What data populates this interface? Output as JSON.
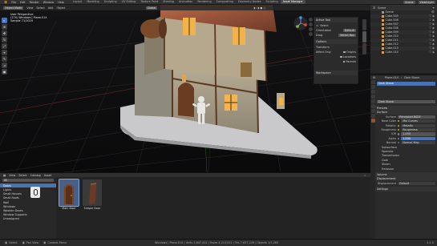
{
  "topbar": {
    "menus": [
      "File",
      "Edit",
      "Render",
      "Window",
      "Help"
    ],
    "tabs": [
      "Layout",
      "Modeling",
      "Sculpting",
      "UV Editing",
      "Texture Paint",
      "Shading",
      "Animation",
      "Rendering",
      "Compositing",
      "Geometry Nodes",
      "Scripting",
      "Asset Manager"
    ],
    "active_tab": "Asset Manager",
    "scene_label": "Scene",
    "view_layer_label": "ViewLayer"
  },
  "viewport_header": {
    "mode": "Object Mode",
    "menus": [
      "View",
      "Select",
      "Add",
      "Object"
    ],
    "orientation_label": "Orientation",
    "orientation_value": "Default",
    "drag_label": "Drag",
    "drag_value": "Select Box",
    "global_label": "Global"
  },
  "viewport_info": {
    "line1": "User Perspective",
    "line2": "(174) Windows | Plane.014",
    "line3": "Sample 71/1024"
  },
  "n_panel": {
    "active_tool_title": "Active Tool",
    "tool_name": "Select",
    "orientation_label": "Orientation",
    "orientation_value": "Default",
    "drag_label": "Drag",
    "drag_value": "Select Box",
    "options_title": "Options",
    "transform_label": "Transform",
    "affect_only_label": "Affect Only",
    "origins_label": "Origins",
    "locations_label": "Locations",
    "parents_label": "Parents",
    "workspace_title": "Workspace"
  },
  "asset_browser": {
    "menus": [
      "View",
      "Select",
      "Catalog",
      "Asset"
    ],
    "library": "All",
    "categories": [
      "Unassigned",
      "Doors",
      "Lights",
      "Small Houses",
      "Small Roofs",
      "Wall",
      "Windows",
      "Wooden Doors",
      "Window Supports",
      "Unassigned"
    ],
    "active_category": "Doors",
    "assets": [
      {
        "label": "Main Door",
        "active": true
      },
      {
        "label": "Simple Door",
        "active": false
      }
    ]
  },
  "outliner": {
    "title": "Scene",
    "items": [
      "Scene",
      "Cube.005",
      "Cube.006",
      "Cube.007",
      "Cube.008",
      "Cube.009",
      "Cube.010",
      "Cube.011",
      "Cube.012",
      "Cube.013",
      "Cube.014"
    ]
  },
  "properties": {
    "breadcrumb_object": "Plane.014",
    "breadcrumb_material": "Dark Stone",
    "material_slot": "Dark Stone",
    "material_name": "Dark Stone",
    "preview_label": "Preview",
    "surface_label": "Surface",
    "surface_value": "Principled BSDF",
    "fields": [
      {
        "k": "Base Color",
        "v": "Mix Curves"
      },
      {
        "k": "Metallic",
        "v": "Metallic"
      },
      {
        "k": "Roughness",
        "v": "Roughness"
      },
      {
        "k": "IOR",
        "v": "1.450"
      },
      {
        "k": "Alpha",
        "v": "1.000"
      },
      {
        "k": "Normal",
        "v": "Normal Map"
      }
    ],
    "sections": [
      "Subsurface",
      "Specular",
      "Transmission",
      "Coat",
      "Sheen",
      "Emission"
    ],
    "volume_label": "Volume",
    "displacement_section": "Displacement",
    "displacement_label": "Displacement",
    "displacement_value": "Default",
    "settings_label": "Settings"
  },
  "statusbar": {
    "select": "Select",
    "pan": "Pan View",
    "context": "Context Menu",
    "stats": "Windows | Plane.014 | Verts 3,847,422 | Faces 4,213,521 | Tris 7,637,226 | Objects 1/1,283",
    "version": "4.1.0"
  },
  "colors": {
    "accent": "#4772b3",
    "panel": "#2b2b2b",
    "viewport": "#0f0f10"
  }
}
